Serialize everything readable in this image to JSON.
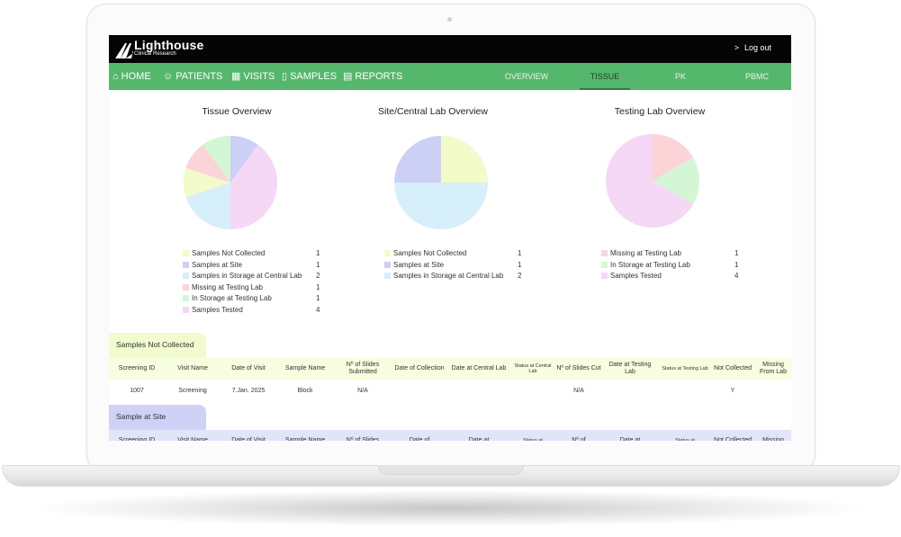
{
  "app": {
    "logo_title": "Lighthouse",
    "logo_subtitle": "Clinical Research",
    "logout_label": "Log out"
  },
  "nav": {
    "items": [
      {
        "label": "HOME",
        "icon": "home-icon"
      },
      {
        "label": "PATIENTS",
        "icon": "people-icon"
      },
      {
        "label": "VISITS",
        "icon": "calendar-icon"
      },
      {
        "label": "SAMPLES",
        "icon": "test-tube-icon"
      },
      {
        "label": "REPORTS",
        "icon": "report-icon"
      }
    ],
    "subtabs": [
      {
        "label": "OVERVIEW",
        "active": false
      },
      {
        "label": "TISSUE",
        "active": true
      },
      {
        "label": "PK",
        "active": false
      },
      {
        "label": "PBMC",
        "active": false
      }
    ],
    "colors": {
      "nav_bg": "#55b76c",
      "top_bg": "#050505"
    }
  },
  "chart_data": [
    {
      "type": "pie",
      "title": "Tissue Overview",
      "categories": [
        "Samples Not  Collected",
        "Samples at Site",
        "Samples in Storage at Central Lab",
        "Missing at Testing Lab",
        "In Storage at Testing Lab",
        "Samples Tested"
      ],
      "values": [
        1,
        1,
        2,
        1,
        1,
        4
      ],
      "colors": [
        "#f2fbc9",
        "#ccd0f7",
        "#d7eefb",
        "#fbd4d8",
        "#d3f7d4",
        "#f4d8f6"
      ]
    },
    {
      "type": "pie",
      "title": "Site/Central Lab Overview",
      "categories": [
        "Samples Not  Collected",
        "Samples at Site",
        "Samples in Storage at Central Lab"
      ],
      "values": [
        1,
        1,
        2
      ],
      "colors": [
        "#f2fbc9",
        "#ccd0f7",
        "#d7eefb"
      ]
    },
    {
      "type": "pie",
      "title": "Testing Lab Overview",
      "categories": [
        "Missing at Testing Lab",
        "In Storage at Testing Lab",
        "Samples Tested"
      ],
      "values": [
        1,
        1,
        4
      ],
      "colors": [
        "#fbd4d8",
        "#d3f7d4",
        "#f4d8f6"
      ]
    }
  ],
  "tables": [
    {
      "title": "Samples Not Collected",
      "tab_color": "#f1fbcd",
      "header_color": "#f7fddf",
      "columns": [
        "Screening ID",
        "Visit Name",
        "Date of Visit",
        "Sample Name",
        "Nº of Slides Submitted",
        "Date of Collection",
        "Date at Central Lab",
        "Status at Central Lab",
        "Nº of Slides Cut",
        "Date at Testing Lab",
        "Status at Testing Lab",
        "Not Collected",
        "Missing From Lab"
      ],
      "rows": [
        [
          "1007",
          "Screening",
          "7.Jan. 2025",
          "Block",
          "N/A",
          "",
          "",
          "",
          "N/A",
          "",
          "",
          "Y",
          ""
        ]
      ]
    },
    {
      "title": "Sample at Site",
      "tab_color": "#cfd2f6",
      "header_color": "#e2e5fa",
      "columns": [
        "Screening ID",
        "Visit Name",
        "Date of Visit",
        "Sample Name",
        "Nº of Slides",
        "Date of",
        "Date at",
        "Status at",
        "Nº of",
        "Date at",
        "Status at",
        "Not Collected",
        "Missing"
      ],
      "rows": []
    }
  ]
}
